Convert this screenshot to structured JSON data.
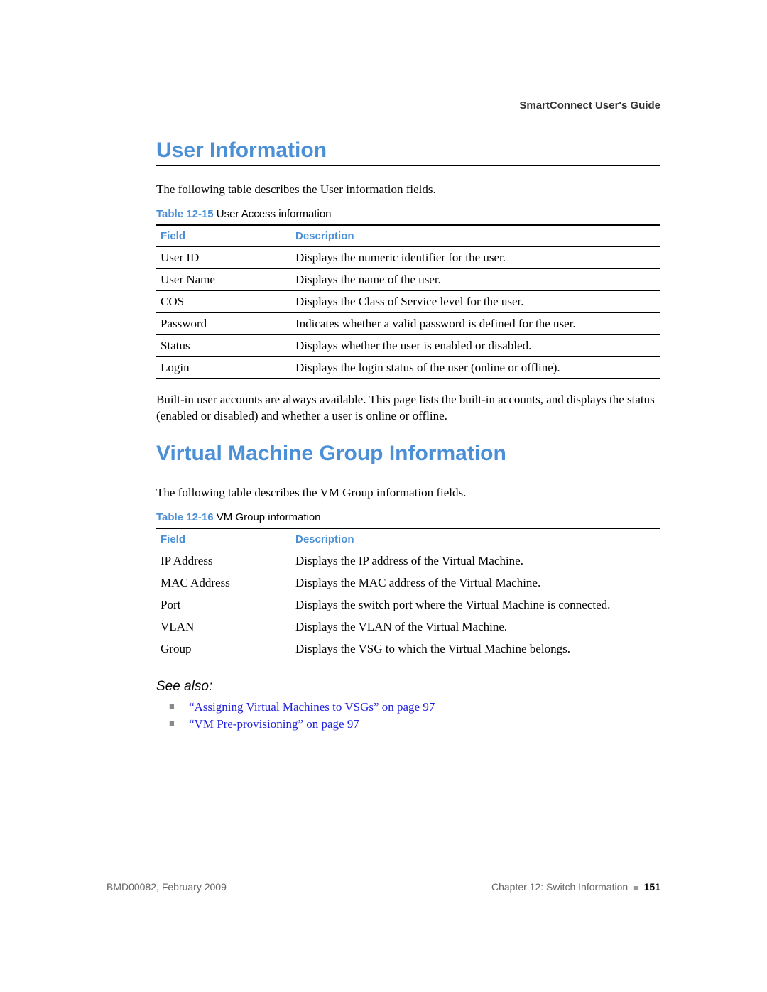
{
  "running_header": "SmartConnect User's Guide",
  "sections": {
    "user_info": {
      "title": "User Information",
      "intro": "The following table describes the User information fields.",
      "table_label": "Table 12-15",
      "table_caption": "User Access information",
      "col_field": "Field",
      "col_desc": "Description",
      "rows": [
        {
          "field": "User ID",
          "desc": "Displays the numeric identifier for the user."
        },
        {
          "field": "User Name",
          "desc": "Displays the name of the user."
        },
        {
          "field": "COS",
          "desc": "Displays the Class of Service level for the user."
        },
        {
          "field": "Password",
          "desc": "Indicates whether a valid password is defined for the user."
        },
        {
          "field": "Status",
          "desc": "Displays whether the user is enabled or disabled."
        },
        {
          "field": "Login",
          "desc": "Displays the login status of the user (online or offline)."
        }
      ],
      "post_para": "Built-in user accounts are always available. This page lists the built-in accounts, and displays the status (enabled or disabled) and whether a user is online or offline."
    },
    "vm_group": {
      "title": "Virtual Machine Group Information",
      "intro": "The following table describes the VM Group information fields.",
      "table_label": "Table 12-16",
      "table_caption": "VM Group information",
      "col_field": "Field",
      "col_desc": "Description",
      "rows": [
        {
          "field": "IP Address",
          "desc": "Displays the IP address of the Virtual Machine."
        },
        {
          "field": "MAC Address",
          "desc": "Displays the MAC address of the Virtual Machine."
        },
        {
          "field": "Port",
          "desc": "Displays the switch port where the Virtual Machine is connected."
        },
        {
          "field": "VLAN",
          "desc": "Displays the VLAN of the Virtual Machine."
        },
        {
          "field": "Group",
          "desc": "Displays the VSG to which the Virtual Machine belongs."
        }
      ]
    }
  },
  "see_also": {
    "heading": "See also:",
    "links": [
      "“Assigning Virtual Machines to VSGs” on page 97",
      "“VM Pre-provisioning” on page 97"
    ]
  },
  "footer": {
    "left": "BMD00082, February 2009",
    "chapter": "Chapter 12: Switch Information",
    "page": "151"
  }
}
